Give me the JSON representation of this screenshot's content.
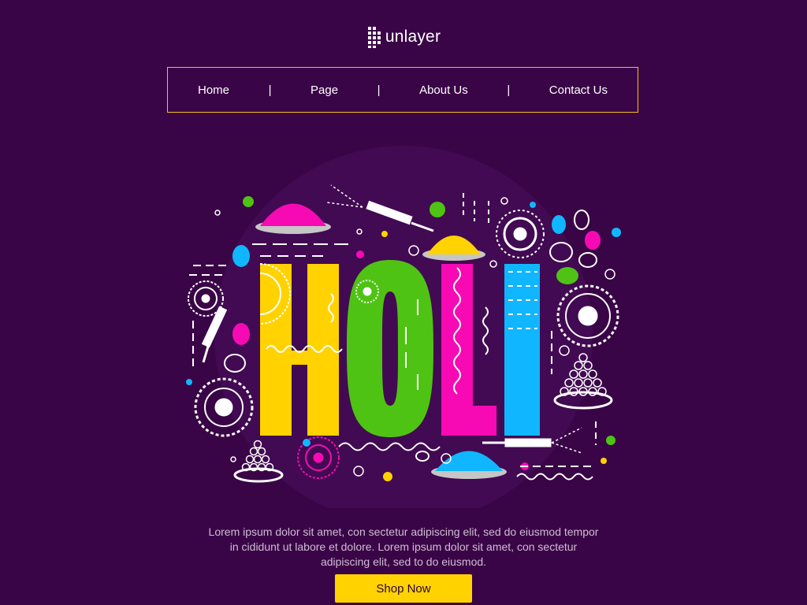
{
  "brand": {
    "name": "unlayer",
    "icon": "unlayer-logo-icon"
  },
  "nav": {
    "items": [
      {
        "label": "Home"
      },
      {
        "label": "Page"
      },
      {
        "label": "About Us"
      },
      {
        "label": "Contact Us"
      }
    ],
    "separator": "|"
  },
  "hero": {
    "letters": [
      "H",
      "O",
      "L",
      "I"
    ],
    "colors": {
      "h": "#ffd200",
      "o": "#4fc313",
      "l": "#f70ab4",
      "i": "#10b6ff",
      "background": "#3a0547",
      "border": "#f3c21a"
    }
  },
  "content": {
    "description": "Lorem ipsum dolor sit amet, con sectetur adipiscing elit, sed do eiusmod tempor in cididunt ut labore et dolore. Lorem ipsum dolor sit amet, con sectetur adipiscing elit, sed to do eiusmod.",
    "cta_label": "Shop Now"
  }
}
